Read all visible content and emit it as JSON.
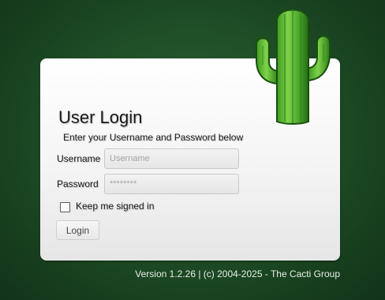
{
  "login": {
    "title": "User Login",
    "subtitle": "Enter your Username and Password below",
    "username_label": "Username",
    "username_placeholder": "Username",
    "username_value": "",
    "password_label": "Password",
    "password_placeholder": "********",
    "password_value": "",
    "remember_label": "Keep me signed in",
    "remember_checked": false,
    "submit_label": "Login"
  },
  "footer": {
    "version_text": "Version 1.2.26 | (c) 2004-2025 - The Cacti Group"
  },
  "logo": {
    "icon": "cactus-icon",
    "colors": {
      "light": "#7fd24a",
      "mid": "#4aa62a",
      "dark": "#236b14",
      "outline": "#1a4f0f"
    }
  },
  "theme": {
    "background": "#1f4f27",
    "card_background": "#f4f4f4",
    "text": "#1b1b1b",
    "footer_text": "#e9eee9"
  }
}
